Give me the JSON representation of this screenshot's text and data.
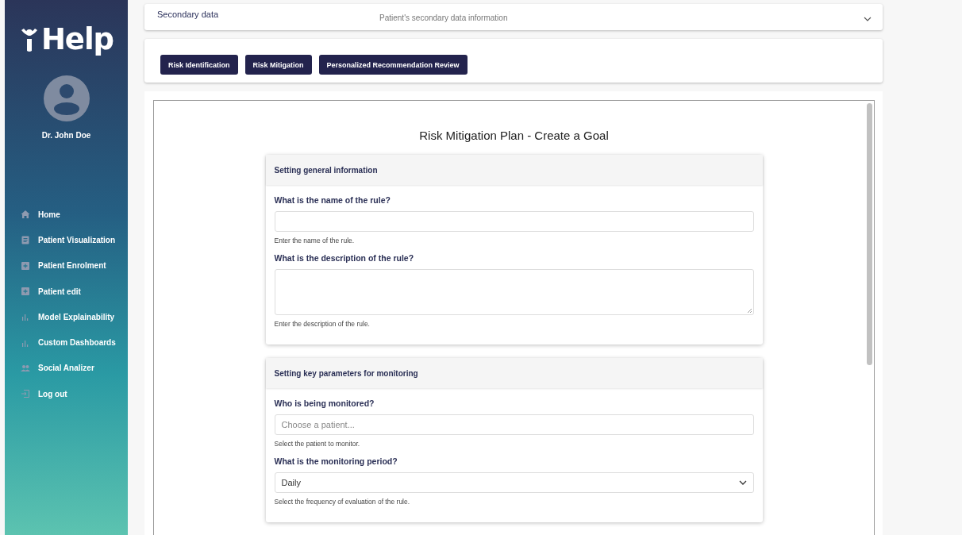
{
  "sidebar": {
    "logo": "Help",
    "user": "Dr. John Doe",
    "items": [
      {
        "label": "Home",
        "kind": "home"
      },
      {
        "label": "Patient Visualization",
        "kind": "clipboard"
      },
      {
        "label": "Patient Enrolment",
        "kind": "plus"
      },
      {
        "label": "Patient edit",
        "kind": "plus"
      },
      {
        "label": "Model Explainability",
        "kind": "bars"
      },
      {
        "label": "Custom Dashboards",
        "kind": "bars"
      },
      {
        "label": "Social Analizer",
        "kind": "people"
      },
      {
        "label": "Log out",
        "kind": "logout"
      }
    ]
  },
  "secondary": {
    "title": "Secondary data",
    "subtitle": "Patient's secondary data information",
    "expanded": false
  },
  "buttons": [
    "Risk Identification",
    "Risk Mitigation",
    "Personalized Recommendation Review"
  ],
  "form": {
    "title": "Risk Mitigation Plan - Create a Goal",
    "sections": [
      {
        "heading": "Setting general information",
        "fields": [
          {
            "kind": "text",
            "label": "What is the name of the rule?",
            "help": "Enter the name of the rule."
          },
          {
            "kind": "textarea",
            "label": "What is the description of the rule?",
            "help": "Enter the description of the rule."
          }
        ]
      },
      {
        "heading": "Setting key parameters for monitoring",
        "fields": [
          {
            "kind": "text",
            "label": "Who is being monitored?",
            "placeholder": "Choose a patient...",
            "help": "Select the patient to monitor."
          },
          {
            "kind": "select",
            "label": "What is the monitoring period?",
            "value": "Daily",
            "help": "Select the frequency of evaluation of the rule."
          }
        ]
      }
    ]
  }
}
